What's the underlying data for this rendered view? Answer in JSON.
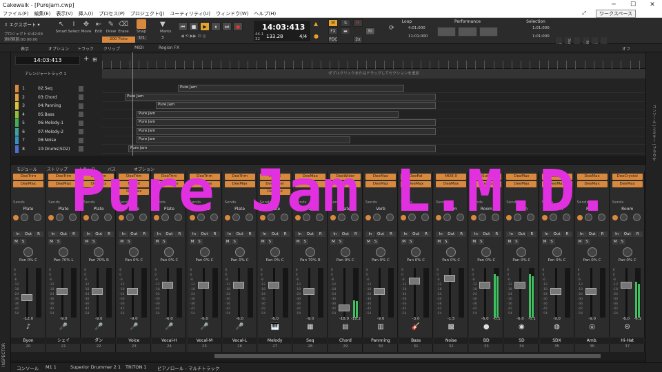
{
  "window": {
    "title": "Cakewalk - [PureJam.cwp]",
    "minimize": "─",
    "maximize": "☐",
    "close": "✕"
  },
  "menu": {
    "items": [
      "ファイル(F)",
      "編集(E)",
      "表示(V)",
      "挿入(I)",
      "プロセス(P)",
      "プロジェクト(J)",
      "ユーティリティ(U)",
      "ウィンドウ(W)",
      "ヘルプ(H)"
    ],
    "workspace": "ワークスペース"
  },
  "control": {
    "export": "エクスポート",
    "project_label": "プロジェクト:0:42:09",
    "selection_label": "選択範囲:00:00:00",
    "tools": [
      "Smart",
      "Select",
      "Move",
      "Edit",
      "Draw",
      "Erase"
    ],
    "snap": "Snap",
    "ticks": "200 Ticks",
    "marks": "Marks",
    "snap_val": "1/1",
    "marks_val": "3",
    "time": "14:03:413",
    "tempo": "133.28",
    "meter": "4/4",
    "beat_a": "44.1",
    "beat_b": "32",
    "modes": [
      "M",
      "S",
      "R",
      "FX",
      "PDC",
      "2x",
      "RI"
    ],
    "loop": {
      "title": "Loop",
      "start": "4:01:000",
      "end": "11:01:000"
    },
    "performance": {
      "title": "Performance"
    },
    "selection": {
      "title": "Selection",
      "start": "1:01:000",
      "end": "1:01:000"
    },
    "vtabs": [
      "Ports",
      "Screenset",
      "ACT",
      "Markers",
      "Snap",
      "Mix"
    ]
  },
  "trackmenu": {
    "items": [
      "表示",
      "オプション",
      "トラック",
      "クリップ",
      "MIDI",
      "Region FX"
    ],
    "right": "オフ"
  },
  "tracks": {
    "now_time": "14:03:413",
    "arranger_label": "アレンジャートラック 1",
    "arranger_hint": "ダブルクリックまたはドラッグしてセクションを追加",
    "rows": [
      {
        "num": "1",
        "name": "02:Seq",
        "color": "#d9893e"
      },
      {
        "num": "2",
        "name": "03:Chord",
        "color": "#e0a03a"
      },
      {
        "num": "3",
        "name": "04:Panning",
        "color": "#d9c23a"
      },
      {
        "num": "4",
        "name": "05:Bass",
        "color": "#8fbf3a"
      },
      {
        "num": "5",
        "name": "06:Melody-1",
        "color": "#3faf5a"
      },
      {
        "num": "6",
        "name": "07:Melody-2",
        "color": "#3fa0a0"
      },
      {
        "num": "7",
        "name": "08:Noise",
        "color": "#3a8fbf"
      },
      {
        "num": "8",
        "name": "10:Drums(SD2)",
        "color": "#4a6fd0"
      }
    ],
    "clip_name": "Pure Jam",
    "right_vertical": "コンソール | ミキサー | ブラウザ"
  },
  "console_menu": {
    "items": [
      "モジュール",
      "ストリップ",
      "トラック",
      "バス",
      "オプション"
    ]
  },
  "console": {
    "sends_label": "Sends",
    "io_labels": [
      "In",
      "Out",
      "R"
    ],
    "strips": [
      {
        "fx": [
          "DeeTrim",
          "DeeMax"
        ],
        "send": "Plate",
        "pan": "Pan 0% C",
        "vol": "-12.0",
        "icon": "guitar-icon",
        "glyph": "♪",
        "name": "Byon",
        "num": "20",
        "fader": 0.56,
        "meter": 0
      },
      {
        "fx": [
          "DeeTrim",
          "DeeMax"
        ],
        "send": "Plate",
        "pan": "Pan 70% L",
        "vol": "-9.0",
        "icon": "microphone-icon",
        "glyph": "🎤",
        "name": "シェイ",
        "num": "21",
        "fader": 0.42,
        "meter": 0
      },
      {
        "fx": [
          "DeeTrim",
          "DeeMax"
        ],
        "send": "Plate",
        "pan": "Pan 70% R",
        "vol": "-9.0",
        "icon": "microphone-icon",
        "glyph": "🎤",
        "name": "ダン",
        "num": "22",
        "fader": 0.42,
        "meter": 0
      },
      {
        "fx": [
          "DeeTrim",
          "MDE-X",
          "DeeMax"
        ],
        "send": "Plate",
        "pan": "Pan 0% C",
        "vol": "-9.0",
        "icon": "microphone-icon",
        "glyph": "🎤",
        "name": "Voice",
        "num": "23",
        "fader": 0.42,
        "meter": 0
      },
      {
        "fx": [
          "DeeTrim",
          "DeeWider"
        ],
        "send": "Plate",
        "pan": "Pan 0% C",
        "vol": "-6.0",
        "icon": "microphone-icon",
        "glyph": "🎤",
        "name": "Vocal-H",
        "num": "24",
        "fader": 0.3,
        "meter": 0
      },
      {
        "fx": [
          "DeeTrim",
          "DeeMax"
        ],
        "send": "Plate",
        "pan": "Pan 0% C",
        "vol": "-6.0",
        "icon": "microphone-icon",
        "glyph": "🎤",
        "name": "Vocal-M",
        "num": "25",
        "fader": 0.3,
        "meter": 0
      },
      {
        "fx": [
          "DeeTrim",
          "DeeMax"
        ],
        "send": "Plate",
        "pan": "Pan 0% C",
        "vol": "-6.0",
        "icon": "microphone-icon",
        "glyph": "🎤",
        "name": "Vocal-L",
        "num": "26",
        "fader": 0.3,
        "meter": 0
      },
      {
        "fx": [
          "MDE-X",
          "DeeWider",
          "DeeMax"
        ],
        "send": "Plate",
        "pan": "Pan 0% C",
        "vol": "-6.0",
        "icon": "synth-icon",
        "glyph": "🎹",
        "name": "Melody",
        "num": "27",
        "fader": 0.3,
        "meter": 0
      },
      {
        "fx": [
          "DeeMax",
          "DeeMax"
        ],
        "send": "Plate",
        "pan": "Pan 70% R",
        "vol": "-9.0",
        "icon": "sequencer-icon",
        "glyph": "▦",
        "name": "Seq",
        "num": "28",
        "fader": 0.42,
        "meter": 0
      },
      {
        "fx": [
          "DeeWider",
          "DeeMax"
        ],
        "send": "Plate",
        "pan": "Pan 0% C",
        "vol": "-18.0",
        "vol2": "-18.2",
        "icon": "keyboard-icon",
        "glyph": "▤",
        "name": "Chord",
        "num": "29",
        "fader": 0.78,
        "meter": 0.35
      },
      {
        "fx": [
          "DeeMax",
          "DeeMax"
        ],
        "send": "Verb",
        "pan": "Pan 0% C",
        "vol": "-9.0",
        "icon": "keyboard-icon",
        "glyph": "▥",
        "name": "Pannning",
        "num": "30",
        "fader": 0.42,
        "meter": 0
      },
      {
        "fx": [
          "DeeFat",
          "DeeMax"
        ],
        "send": "Room",
        "pan": "Pan 0% C",
        "vol": "-3.0",
        "icon": "bass-icon",
        "glyph": "🎸",
        "name": "Bass",
        "num": "31",
        "fader": 0.2,
        "meter": 0
      },
      {
        "fx": [
          "MDE-X",
          "DeeMax"
        ],
        "send": "Room",
        "pan": "Pan 0% C",
        "vol": "-1.5",
        "icon": "noise-icon",
        "glyph": "▩",
        "name": "Noise",
        "num": "32",
        "fader": 0.14,
        "meter": 0
      },
      {
        "fx": [
          "DeeSubBass",
          "DeeMax"
        ],
        "send": "Room",
        "pan": "Pan 0% C",
        "vol": "-6.0",
        "vol2": "-0.1",
        "icon": "kick-drum-icon",
        "glyph": "●",
        "name": "BD",
        "num": "33",
        "fader": 0.3,
        "meter": 0.88
      },
      {
        "fx": [
          "DeeMax",
          "DeeMax"
        ],
        "send": "Room",
        "pan": "Pan 0% C",
        "vol": "-6.0",
        "vol2": "-0.1",
        "icon": "snare-drum-icon",
        "glyph": "◉",
        "name": "SD",
        "num": "34",
        "fader": 0.3,
        "meter": 0.88
      },
      {
        "fx": [
          "DeeMax",
          "DeeMax"
        ],
        "send": "Room",
        "pan": "Pan 0% C",
        "vol": "-9.0",
        "icon": "drum-icon",
        "glyph": "◍",
        "name": "SDX",
        "num": "35",
        "fader": 0.42,
        "meter": 0
      },
      {
        "fx": [
          "DeeMax",
          "DeeMax"
        ],
        "send": "Room",
        "pan": "Pan 0% C",
        "vol": "-9.0",
        "icon": "drum-icon",
        "glyph": "◎",
        "name": "Amb.",
        "num": "36",
        "fader": 0.42,
        "meter": 0
      },
      {
        "fx": [
          "DeeCrystal",
          "DeeMax"
        ],
        "send": "Room",
        "pan": "Pan 0% C",
        "vol": "-6.0",
        "vol2": "-6.1",
        "icon": "hihat-icon",
        "glyph": "⊜",
        "name": "Hi-Hat",
        "num": "37",
        "fader": 0.3,
        "meter": 0.72
      }
    ]
  },
  "overlay_text": "Pure Jam L.M.D.",
  "inspector": "INSPECTOR",
  "bottomtabs": [
    "コンソール",
    "M1 1",
    "Superior Drummer 2 1",
    "TRITON 1",
    "ピアノロール - マルチトラック"
  ]
}
